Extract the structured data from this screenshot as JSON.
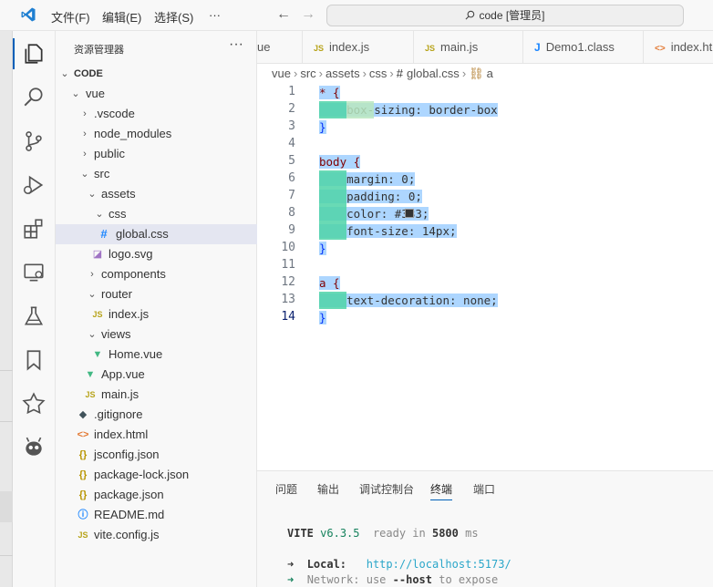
{
  "titlebar": {
    "menus": [
      "文件(F)",
      "编辑(E)",
      "选择(S)",
      "···"
    ],
    "command_center": "code [管理员]"
  },
  "sidebar": {
    "title": "资源管理器",
    "more": "···",
    "root": "CODE",
    "tree": [
      {
        "label": "vue",
        "kind": "folder-open",
        "depth": 1
      },
      {
        "label": ".vscode",
        "kind": "folder",
        "depth": 2
      },
      {
        "label": "node_modules",
        "kind": "folder",
        "depth": 2
      },
      {
        "label": "public",
        "kind": "folder",
        "depth": 2
      },
      {
        "label": "src",
        "kind": "folder-open",
        "depth": 2
      },
      {
        "label": "assets",
        "kind": "folder-open",
        "depth": 3
      },
      {
        "label": "css",
        "kind": "folder-open",
        "depth": 4
      },
      {
        "label": "global.css",
        "kind": "css",
        "depth": 5,
        "selected": true
      },
      {
        "label": "logo.svg",
        "kind": "svg",
        "depth": 4
      },
      {
        "label": "components",
        "kind": "folder",
        "depth": 3
      },
      {
        "label": "router",
        "kind": "folder-open",
        "depth": 3
      },
      {
        "label": "index.js",
        "kind": "js",
        "depth": 4
      },
      {
        "label": "views",
        "kind": "folder-open",
        "depth": 3
      },
      {
        "label": "Home.vue",
        "kind": "vue",
        "depth": 4
      },
      {
        "label": "App.vue",
        "kind": "vue",
        "depth": 3
      },
      {
        "label": "main.js",
        "kind": "js",
        "depth": 3
      },
      {
        "label": ".gitignore",
        "kind": "git",
        "depth": 2
      },
      {
        "label": "index.html",
        "kind": "html",
        "depth": 2
      },
      {
        "label": "jsconfig.json",
        "kind": "json",
        "depth": 2
      },
      {
        "label": "package-lock.json",
        "kind": "json",
        "depth": 2
      },
      {
        "label": "package.json",
        "kind": "json",
        "depth": 2
      },
      {
        "label": "README.md",
        "kind": "info",
        "depth": 2
      },
      {
        "label": "vite.config.js",
        "kind": "js",
        "depth": 2
      }
    ]
  },
  "tabs": [
    {
      "label": "ue",
      "icon": ""
    },
    {
      "label": "index.js",
      "icon": "JS"
    },
    {
      "label": "main.js",
      "icon": "JS"
    },
    {
      "label": "Demo1.class",
      "icon": "J"
    },
    {
      "label": "index.ht",
      "icon": "<>"
    }
  ],
  "breadcrumb": [
    "vue",
    "src",
    "assets",
    "css",
    "global.css",
    "a"
  ],
  "breadcrumb_icons": {
    "css": "#",
    "selector": "⛓"
  },
  "code": {
    "line_numbers": [
      "1",
      "2",
      "3",
      "4",
      "5",
      "6",
      "7",
      "8",
      "9",
      "10",
      "11",
      "12",
      "13",
      "14"
    ],
    "current_line": "14",
    "lines": [
      "* {",
      "    box-sizing: border-box",
      "}",
      "",
      "body {",
      "    margin: 0;",
      "    padding: 0;",
      "    color: #333;",
      "    font-size: 14px;",
      "}",
      "",
      "a {",
      "    text-decoration: none;",
      "}"
    ]
  },
  "panel": {
    "tabs": [
      "问题",
      "输出",
      "调试控制台",
      "终端",
      "端口"
    ],
    "active_tab": "终端",
    "terminal": {
      "vite": "VITE",
      "version": "v6.3.5",
      "ready": "ready in",
      "ms_value": "5800",
      "ms_unit": "ms",
      "arrow": "➜",
      "local_label": "Local:",
      "local_url": "http://localhost:5173/",
      "network_label": "Network:",
      "network_use": "use",
      "network_host": "--host",
      "network_expose": "to expose"
    }
  },
  "colors": {
    "accent": "#005fb8",
    "selection": "#add6ff",
    "indent_guide": "#4fd4a8"
  }
}
